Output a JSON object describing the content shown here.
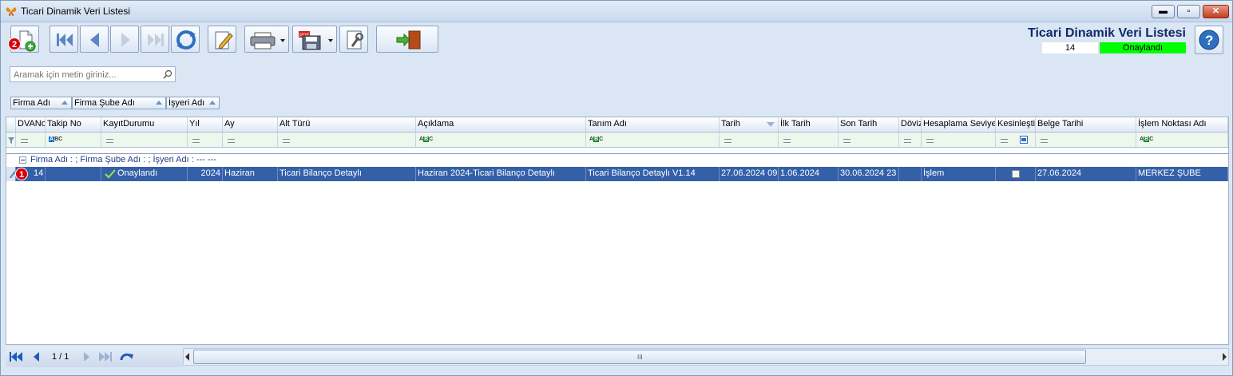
{
  "window": {
    "title": "Ticari Dinamik Veri Listesi",
    "controls": {
      "minimize": "▬",
      "maximize": "▫",
      "close": "✕"
    }
  },
  "toolbar": {
    "badge_new": "2",
    "buttons": [
      "new-record",
      "first",
      "previous",
      "next",
      "last",
      "refresh",
      "edit",
      "print",
      "export-pdf",
      "settings",
      "exit"
    ]
  },
  "header": {
    "title": "Ticari Dinamik Veri Listesi",
    "record_no": "14",
    "status": "Onaylandı",
    "status_color": "#00ff00"
  },
  "search": {
    "placeholder": "Aramak için metin giriniz..."
  },
  "group_panel": [
    "Firma Adı",
    "Firma Şube Adı",
    "İşyeri Adı"
  ],
  "grid": {
    "columns": [
      "DVANo",
      "Takip No",
      "KayıtDurumu",
      "Yıl",
      "Ay",
      "Alt Türü",
      "Açıklama",
      "Tanım Adı",
      "Tarih",
      "İlk Tarih",
      "Son Tarih",
      "Döviz",
      "Hesaplama Seviyesi",
      "Kesinleşti",
      "Belge Tarihi",
      "İşlem Noktası Adı"
    ],
    "group_row": "Firma Adı : ; Firma Şube Adı : ; İşyeri Adı : --- ---",
    "row_badge": "1",
    "rows": [
      {
        "dvano": "14",
        "takip_no": "",
        "kayit_durumu": "Onaylandı",
        "yil": "2024",
        "ay": "Haziran",
        "alt_turu": "Ticari Bilanço Detaylı",
        "aciklama": "Haziran 2024-Ticari Bilanço Detaylı",
        "tanim_adi": "Ticari Bilanço Detaylı V1.14",
        "tarih": "27.06.2024 09",
        "ilk_tarih": "1.06.2024",
        "son_tarih": "30.06.2024 23",
        "doviz": "",
        "hesaplama_seviyesi": "İşlem",
        "belge_tarihi": "27.06.2024",
        "islem_noktasi": "MERKEZ ŞUBE"
      }
    ]
  },
  "pager": {
    "page": "1 / 1"
  },
  "scrollbar": {
    "grip": "III"
  },
  "colors": {
    "selected_row": "#3460a8",
    "title_blue": "#0f2a66"
  }
}
